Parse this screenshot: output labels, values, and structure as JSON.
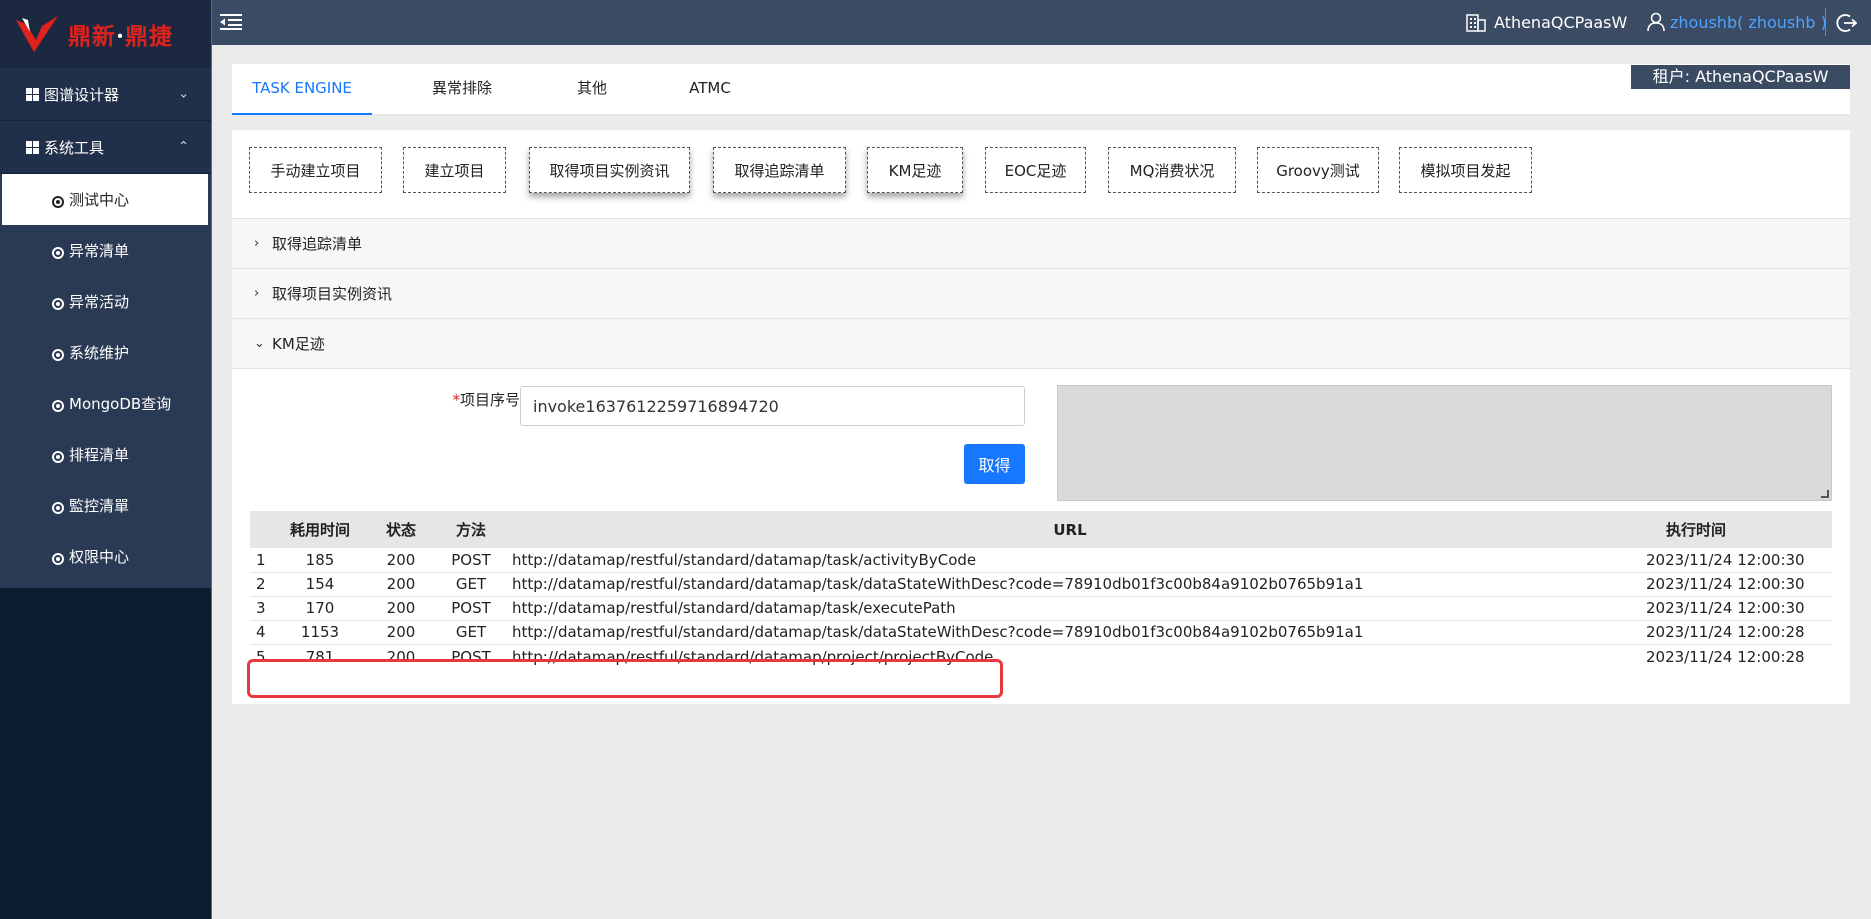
{
  "sidebar": {
    "brand_a": "鼎新",
    "brand_dot": "·",
    "brand_b": "鼎捷",
    "groups": [
      {
        "label": "图谱设计器",
        "chevron": "⌄"
      },
      {
        "label": "系统工具",
        "chevron": "⌃"
      }
    ],
    "items": [
      {
        "label": "测试中心",
        "active": true
      },
      {
        "label": "异常清单"
      },
      {
        "label": "异常活动"
      },
      {
        "label": "系统维护"
      },
      {
        "label": "MongoDB查询"
      },
      {
        "label": "排程清单"
      },
      {
        "label": "監控清單"
      },
      {
        "label": "权限中心"
      }
    ]
  },
  "topbar": {
    "tenant": "AthenaQCPaasW",
    "user": "zhoushb( zhoushb )"
  },
  "tabs": [
    "TASK ENGINE",
    "異常排除",
    "其他",
    "ATMC"
  ],
  "tenant_badge": "租户: AthenaQCPaasW",
  "tool_buttons": [
    "手动建立项目",
    "建立项目",
    "取得项目实例资讯",
    "取得追踪清单",
    "KM足迹",
    "EOC足迹",
    "MQ消费状况",
    "Groovy测试",
    "模拟项目发起"
  ],
  "panels": [
    {
      "title": "取得追踪清单",
      "arrow": "›",
      "open": false
    },
    {
      "title": "取得项目实例资讯",
      "arrow": "›",
      "open": false
    },
    {
      "title": "KM足迹",
      "arrow": "⌄",
      "open": true
    }
  ],
  "km": {
    "required_mark": "*",
    "field_label": "项目序号",
    "field_value": "invoke1637612259716894720",
    "fetch_label": "取得",
    "result_text": ""
  },
  "table": {
    "headers": [
      "",
      "耗用时间",
      "状态",
      "方法",
      "URL",
      "执行时间"
    ],
    "rows": [
      {
        "no": "1",
        "time": "185",
        "status": "200",
        "method": "POST",
        "url": "http://datamap/restful/standard/datamap/task/activityByCode",
        "exec": "2023/11/24 12:00:30"
      },
      {
        "no": "2",
        "time": "154",
        "status": "200",
        "method": "GET",
        "url": "http://datamap/restful/standard/datamap/task/dataStateWithDesc?code=78910db01f3c00b84a9102b0765b91a1",
        "exec": "2023/11/24 12:00:30"
      },
      {
        "no": "3",
        "time": "170",
        "status": "200",
        "method": "POST",
        "url": "http://datamap/restful/standard/datamap/task/executePath",
        "exec": "2023/11/24 12:00:30"
      },
      {
        "no": "4",
        "time": "1153",
        "status": "200",
        "method": "GET",
        "url": "http://datamap/restful/standard/datamap/task/dataStateWithDesc?code=78910db01f3c00b84a9102b0765b91a1",
        "exec": "2023/11/24 12:00:28"
      },
      {
        "no": "5",
        "time": "781",
        "status": "200",
        "method": "POST",
        "url": "http://datamap/restful/standard/datamap/project/projectByCode",
        "exec": "2023/11/24 12:00:28"
      }
    ]
  },
  "colors": {
    "accent": "#1677ff",
    "highlight": "#e8383d",
    "sidebar": "#0d1b2e",
    "topbar": "#3c4b64"
  }
}
